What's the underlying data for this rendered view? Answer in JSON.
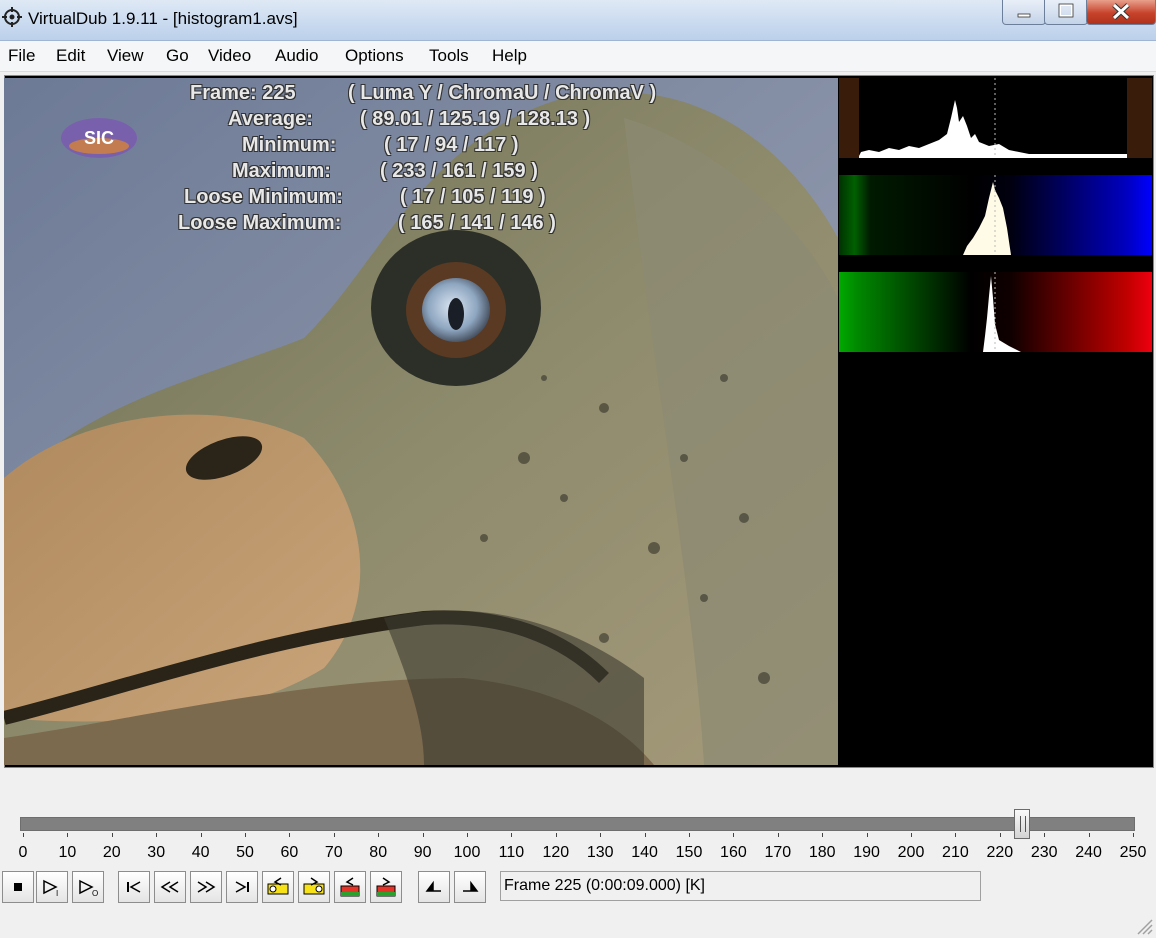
{
  "window": {
    "title": "VirtualDub 1.9.11 - [histogram1.avs]",
    "icon": "virtualdub-app-icon"
  },
  "menu": {
    "items": [
      "File",
      "Edit",
      "View",
      "Go",
      "Video",
      "Audio",
      "Options",
      "Tools",
      "Help"
    ]
  },
  "overlay": {
    "header": "Frame: 225",
    "header_columns": "( Luma Y / ChromaU / ChromaV )",
    "rows": [
      {
        "label": "Average:",
        "values": "(   89.01  /  125.19  /  128.13   )"
      },
      {
        "label": "Minimum:",
        "values": "(    17   /    94   /   117    )"
      },
      {
        "label": "Maximum:",
        "values": "(   233   /   161   /   159    )"
      },
      {
        "label": "Loose Minimum:",
        "values": "(    17   /   105   /   119    )"
      },
      {
        "label": "Loose Maximum:",
        "values": "(   165   /   141   /   146    )"
      }
    ],
    "logo_text": "SIC"
  },
  "timeline": {
    "current_frame": 225,
    "range_max": 250,
    "tick_labels": [
      "0",
      "10",
      "20",
      "30",
      "40",
      "50",
      "60",
      "70",
      "80",
      "90",
      "100",
      "110",
      "120",
      "130",
      "140",
      "150",
      "160",
      "170",
      "180",
      "190",
      "200",
      "210",
      "220",
      "230",
      "240",
      "250"
    ]
  },
  "toolbar": {
    "buttons": [
      {
        "name": "stop-button",
        "icon": "stop-icon"
      },
      {
        "name": "play-input-button",
        "icon": "play-input-icon"
      },
      {
        "name": "play-output-button",
        "icon": "play-output-icon"
      },
      {
        "name": "go-start-button",
        "icon": "go-start-icon"
      },
      {
        "name": "prev-frame-button",
        "icon": "rewind-icon"
      },
      {
        "name": "next-frame-button",
        "icon": "fast-forward-icon"
      },
      {
        "name": "go-end-button",
        "icon": "go-end-icon"
      },
      {
        "name": "prev-keyframe-button",
        "icon": "key-back-icon"
      },
      {
        "name": "next-keyframe-button",
        "icon": "key-forward-icon"
      },
      {
        "name": "prev-scene-button",
        "icon": "scene-back-icon"
      },
      {
        "name": "next-scene-button",
        "icon": "scene-forward-icon"
      },
      {
        "name": "mark-in-button",
        "icon": "mark-in-icon"
      },
      {
        "name": "mark-out-button",
        "icon": "mark-out-icon"
      }
    ],
    "status": "Frame 225 (0:00:09.000) [K]"
  },
  "colors": {
    "titlebar": "#c9daef",
    "close_button": "#c7422a",
    "video_bg": "#000000",
    "track": "#808080"
  }
}
